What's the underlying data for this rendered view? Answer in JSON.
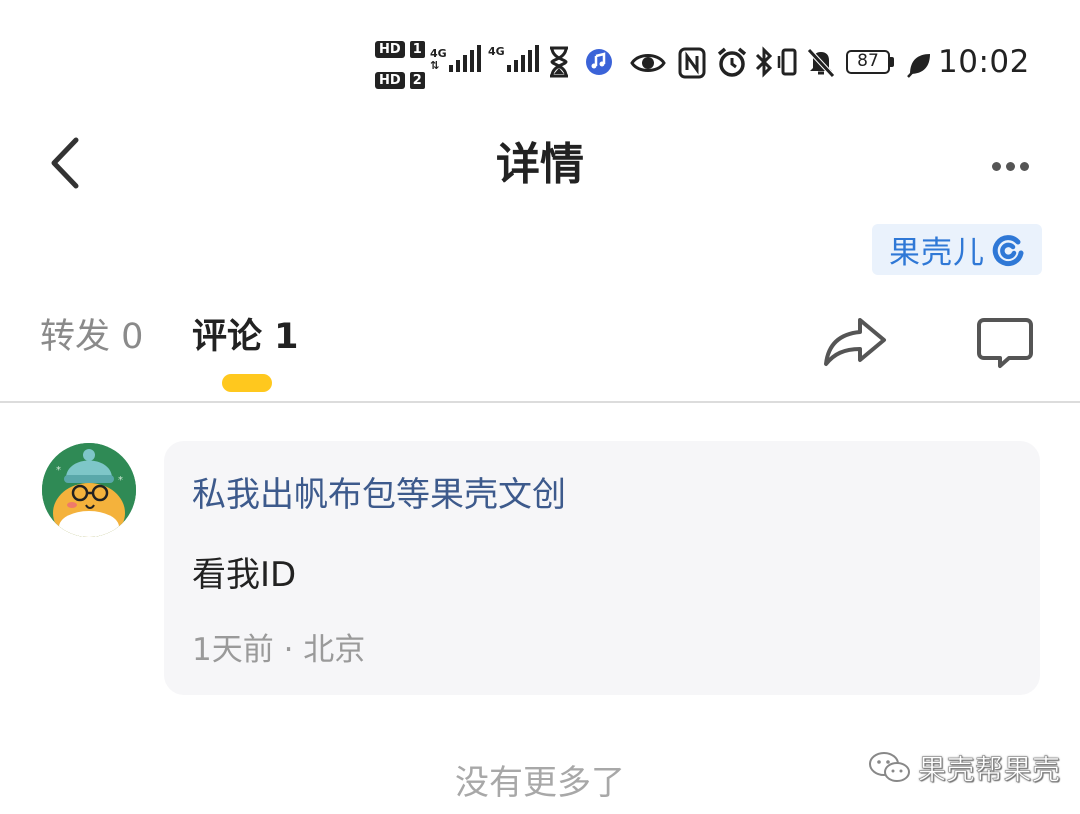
{
  "status_bar": {
    "hd_badges": [
      "HD",
      "HD"
    ],
    "sim_slots": [
      "1",
      "2"
    ],
    "network_types": [
      "4G",
      "4G"
    ],
    "battery_level": "87",
    "time": "10:02",
    "icons": [
      "hourglass-icon",
      "music-app-icon",
      "eye-icon",
      "nfc-icon",
      "alarm-icon",
      "bluetooth-icon",
      "vibrate-icon",
      "mute-icon",
      "battery-icon",
      "leaf-icon"
    ]
  },
  "nav": {
    "title": "详情",
    "back_icon": "chevron-left-icon",
    "more_icon": "more-horizontal-icon"
  },
  "brand_badge": {
    "label": "果壳儿",
    "icon": "guokr-logo-icon"
  },
  "tabs": {
    "forward": "转发 0",
    "comments": "评论 1",
    "active": "comments",
    "indicator_color": "#ffc81e"
  },
  "actions": {
    "share_icon": "share-arrow-icon",
    "comment_icon": "comment-bubble-icon"
  },
  "comments": [
    {
      "author": "私我出帆布包等果壳文创",
      "text": "看我ID",
      "meta": "1天前 · 北京",
      "avatar_icon": "avatar-cat-icon"
    }
  ],
  "footer": {
    "no_more": "没有更多了"
  },
  "watermark": {
    "label": "果壳帮果壳",
    "icon": "wechat-icon"
  },
  "colors": {
    "accent_blue": "#2f78d6",
    "author_blue": "#3d5a8c",
    "card_bg": "#f6f6f8",
    "muted_text": "#9a9a9a"
  }
}
